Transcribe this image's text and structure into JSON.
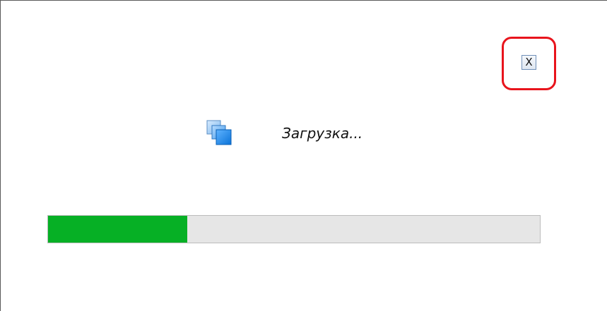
{
  "dialog": {
    "close_button": {
      "label": "X",
      "highlighted": true,
      "highlight_color": "#e8141c"
    },
    "loading": {
      "icon": "copy-windows-icon",
      "text": "Загрузка..."
    },
    "progress": {
      "fraction": 0.283,
      "fill_color": "#06b025",
      "track_color": "#e6e6e6"
    }
  }
}
